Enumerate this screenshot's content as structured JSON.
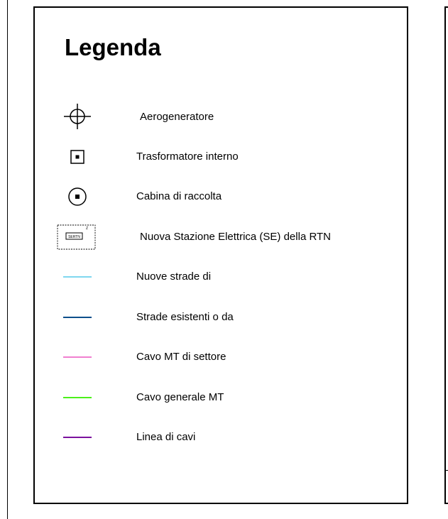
{
  "legend": {
    "title": "Legenda",
    "items": [
      {
        "icon": "wind-turbine-icon",
        "label": "Aerogeneratore"
      },
      {
        "icon": "internal-transformer-icon",
        "label": "Trasformatore interno"
      },
      {
        "icon": "collection-cabin-icon",
        "label": "Cabina di raccolta"
      },
      {
        "icon": "electrical-substation-icon",
        "label": "Nuova Stazione Elettrica (SE) della RTN",
        "icon_text": "SERTN"
      },
      {
        "icon": "line-icon",
        "label": "Nuove strade di",
        "color": "#7fd7ef"
      },
      {
        "icon": "line-icon",
        "label": "Strade esistenti o da",
        "color": "#0d4f8b"
      },
      {
        "icon": "line-icon",
        "label": "Cavo MT di settore",
        "color": "#f07fcf"
      },
      {
        "icon": "line-icon",
        "label": "Cavo generale  MT",
        "color": "#4cf01a"
      },
      {
        "icon": "line-icon",
        "label": "Linea di cavi",
        "color": "#7b129e"
      }
    ]
  }
}
